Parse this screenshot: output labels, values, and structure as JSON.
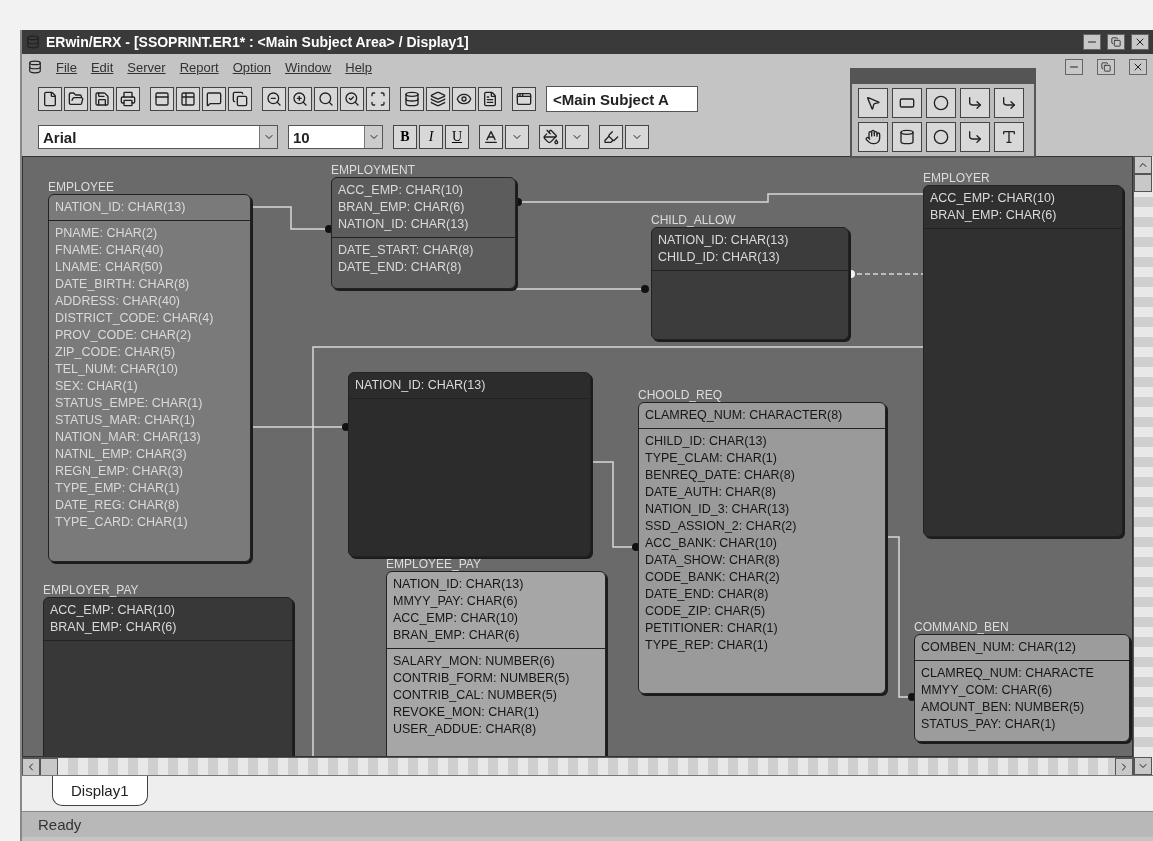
{
  "window": {
    "title": "ERwin/ERX - [SSOPRINT.ER1* : <Main Subject Area> / Display1]"
  },
  "menu": [
    "File",
    "Edit",
    "Server",
    "Report",
    "Option",
    "Window",
    "Help"
  ],
  "toolbar": {
    "subject_area": "<Main Subject A",
    "font": "Arial",
    "font_size": "10",
    "style_buttons": [
      "B",
      "I",
      "U"
    ]
  },
  "entities": [
    {
      "name": "EMPLOYEE",
      "color": "#7a7a7a",
      "keys": [
        "NATION_ID: CHAR(13)"
      ],
      "attributes": [
        "PNAME: CHAR(2)",
        "FNAME: CHAR(40)",
        "LNAME: CHAR(50)",
        "DATE_BIRTH: CHAR(8)",
        "ADDRESS: CHAR(40)",
        "DISTRICT_CODE: CHAR(4)",
        "PROV_CODE: CHAR(2)",
        "ZIP_CODE: CHAR(5)",
        "TEL_NUM: CHAR(10)",
        "SEX: CHAR(1)",
        "STATUS_EMPE: CHAR(1)",
        "STATUS_MAR: CHAR(1)",
        "NATION_MAR: CHAR(13)",
        "NATNL_EMP: CHAR(3)",
        "REGN_EMP: CHAR(3)",
        "TYPE_EMP: CHAR(1)",
        "DATE_REG: CHAR(8)",
        "TYPE_CARD: CHAR(1)"
      ]
    },
    {
      "name": "EMPLOYMENT",
      "color": "#5c5c5c",
      "keys": [
        "ACC_EMP: CHAR(10)",
        "BRAN_EMP: CHAR(6)",
        "NATION_ID: CHAR(13)"
      ],
      "attributes": [
        "DATE_START: CHAR(8)",
        "DATE_END: CHAR(8)"
      ]
    },
    {
      "name": "CHILD_ALLOW",
      "color": "#3c3c3c",
      "keys": [
        "NATION_ID: CHAR(13)",
        "CHILD_ID: CHAR(13)"
      ]
    },
    {
      "name": "EMPLOYER",
      "color": "#303030",
      "keys": [
        "ACC_EMP: CHAR(10)",
        "BRAN_EMP: CHAR(6)"
      ]
    },
    {
      "color": "#2c2c2c",
      "keys": [
        "NATION_ID: CHAR(13)"
      ]
    },
    {
      "name": "CHOOLD_REQ",
      "color": "#9a9a9a",
      "keys": [
        "CLAMREQ_NUM: CHARACTER(8)"
      ],
      "attributes": [
        "CHILD_ID: CHAR(13)",
        "TYPE_CLAM: CHAR(1)",
        "BENREQ_DATE: CHAR(8)",
        "DATE_AUTH: CHAR(8)",
        "NATION_ID_3: CHAR(13)",
        "SSD_ASSION_2: CHAR(2)",
        "ACC_BANK: CHAR(10)",
        "DATA_SHOW: CHAR(8)",
        "CODE_BANK: CHAR(2)",
        "DATE_END: CHAR(8)",
        "CODE_ZIP: CHAR(5)",
        "PETITIONER: CHAR(1)",
        "TYPE_REP: CHAR(1)"
      ]
    },
    {
      "name": "EMPLOYER_PAY",
      "color": "#383838",
      "keys": [
        "ACC_EMP: CHAR(10)",
        "BRAN_EMP: CHAR(6)"
      ]
    },
    {
      "name": "EMPLOYEE_PAY",
      "color": "#a6a6a6",
      "keys": [
        "NATION_ID: CHAR(13)",
        "MMYY_PAY: CHAR(6)",
        "ACC_EMP: CHAR(10)",
        "BRAN_EMP: CHAR(6)"
      ],
      "attributes": [
        "SALARY_MON: NUMBER(6)",
        "CONTRIB_FORM: NUMBER(5)",
        "CONTRIB_CAL: NUMBER(5)",
        "REVOKE_MON: CHAR(1)",
        "USER_ADDUE: CHAR(8)"
      ]
    },
    {
      "name": "COMMAND_BEN",
      "color": "#9c9c9c",
      "keys": [
        "COMBEN_NUM: CHAR(12)"
      ],
      "attributes": [
        "CLAMREQ_NUM: CHARACTE",
        "MMYY_COM: CHAR(6)",
        "AMOUNT_BEN: NUMBER(5)",
        "STATUS_PAY: CHAR(1)"
      ]
    }
  ],
  "tabs": [
    {
      "label": "Display1",
      "selected": true
    }
  ],
  "status_bar": "Ready"
}
